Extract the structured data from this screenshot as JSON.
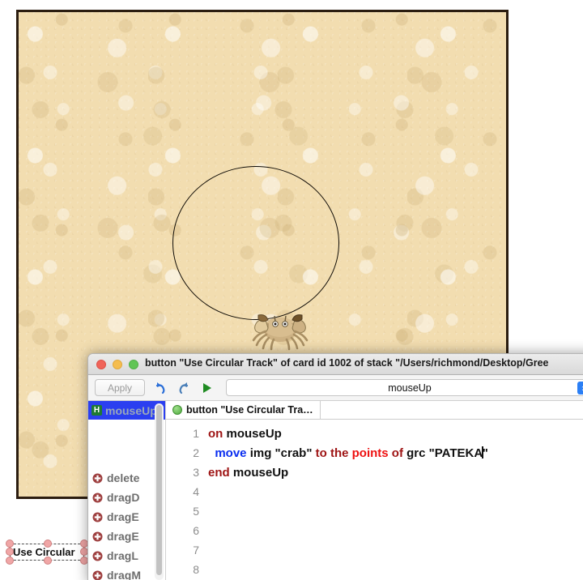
{
  "card": {
    "name": "stack-card",
    "background_color": "#f2ddb0",
    "border_color": "#2b1d10",
    "circle_track": {
      "name": "PATEKA",
      "stroke_color": "#100c06"
    },
    "crab_image_name": "crab"
  },
  "desktop_button": {
    "label": "Use Circular",
    "full_label": "Use Circular Track",
    "selected": true,
    "handle_color": "#f0a6a6"
  },
  "window": {
    "title": "button \"Use Circular Track\" of card id 1002 of stack \"/Users/richmond/Desktop/Gree",
    "traffic_lights": [
      "close-red",
      "minimize-yellow",
      "zoom-green"
    ]
  },
  "toolbar": {
    "apply_label": "Apply",
    "undo_icon": "undo-arrow-icon",
    "redo_icon": "redo-arrow-icon",
    "run_icon": "run-play-icon",
    "handler_selector_value": "mouseUp",
    "stepper_icon": "up-down-chevron-icon"
  },
  "sidebar": {
    "selected_handler": {
      "badge": "H",
      "label": "mouseUp"
    },
    "items": [
      {
        "icon": "add-plus-icon",
        "label": "delete"
      },
      {
        "icon": "add-plus-icon",
        "label": "dragD"
      },
      {
        "icon": "add-plus-icon",
        "label": "dragE"
      },
      {
        "icon": "add-plus-icon",
        "label": "dragE"
      },
      {
        "icon": "add-plus-icon",
        "label": "dragL"
      },
      {
        "icon": "add-plus-icon",
        "label": "dragM"
      }
    ]
  },
  "tabs": [
    {
      "icon": "green-circle-icon",
      "label": "button \"Use Circular Tra…"
    }
  ],
  "code": {
    "lines": [
      {
        "number": "1",
        "tokens": [
          {
            "t": "on ",
            "c": "kw-darkred"
          },
          {
            "t": "mouseUp",
            "c": ""
          }
        ]
      },
      {
        "number": "2",
        "tokens": [
          {
            "t": "  ",
            "c": ""
          },
          {
            "t": "move ",
            "c": "kw-blue"
          },
          {
            "t": "img \"crab\" ",
            "c": ""
          },
          {
            "t": "to the ",
            "c": "kw-darkred"
          },
          {
            "t": "points ",
            "c": "kw-red"
          },
          {
            "t": "of ",
            "c": "kw-darkred"
          },
          {
            "t": "grc \"PATEKA",
            "c": ""
          },
          {
            "t": "|",
            "c": "caret"
          },
          {
            "t": "\"",
            "c": ""
          }
        ]
      },
      {
        "number": "3",
        "tokens": [
          {
            "t": "end ",
            "c": "kw-darkred"
          },
          {
            "t": "mouseUp",
            "c": ""
          }
        ]
      },
      {
        "number": "4",
        "tokens": []
      },
      {
        "number": "5",
        "tokens": []
      },
      {
        "number": "6",
        "tokens": []
      },
      {
        "number": "7",
        "tokens": []
      },
      {
        "number": "8",
        "tokens": []
      }
    ]
  }
}
